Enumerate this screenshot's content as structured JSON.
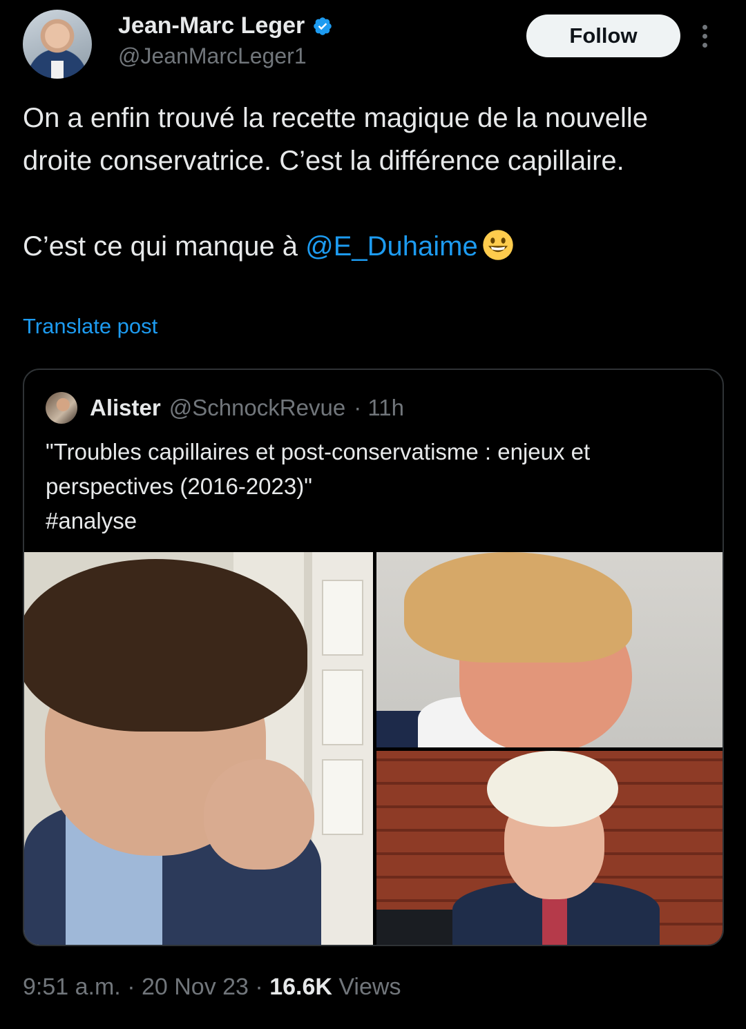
{
  "author": {
    "name": "Jean-Marc Leger",
    "handle": "@JeanMarcLeger1",
    "verified": true
  },
  "follow_label": "Follow",
  "post": {
    "line1": "On a enfin trouvé la recette magique de la nouvelle droite conservatrice. C’est la différence capillaire.",
    "line2_prefix": "C’est ce qui manque à ",
    "mention": "@E_Duhaime",
    "emoji": "😀"
  },
  "translate_label": "Translate post",
  "quote": {
    "name": "Alister",
    "handle": "@SchnockRevue",
    "time": "· 11h",
    "text_line1": "\"Troubles capillaires et post-conservatisme : enjeux et perspectives (2016-2023)\"",
    "text_line2": "#analyse"
  },
  "meta": {
    "time": "9:51 a.m.",
    "sep1": " · ",
    "date": "20 Nov 23",
    "sep2": " · ",
    "views_count": "16.6K",
    "views_label": " Views"
  },
  "colors": {
    "background": "#000000",
    "text": "#e7e9ea",
    "secondary": "#71767b",
    "link": "#1d9bf0",
    "border": "#2f3336"
  }
}
